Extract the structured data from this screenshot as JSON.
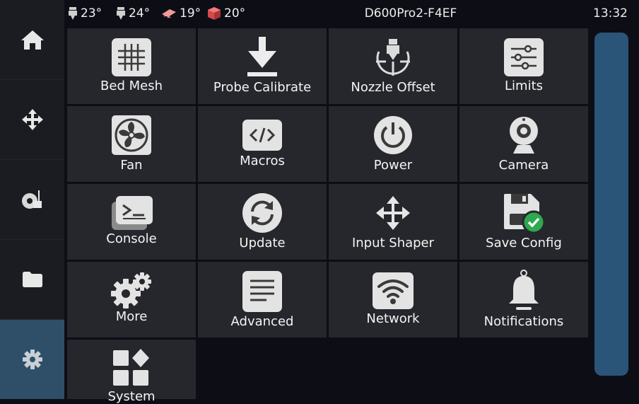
{
  "sidebar": {
    "items": [
      {
        "icon": "home-icon",
        "active": false
      },
      {
        "icon": "move-icon",
        "active": false
      },
      {
        "icon": "filament-spool-icon",
        "active": false
      },
      {
        "icon": "folder-icon",
        "active": false
      },
      {
        "icon": "gear-icon",
        "active": true
      }
    ],
    "active_color": "#2f4f69"
  },
  "status_bar": {
    "temperatures": [
      {
        "icon": "extruder-icon",
        "value": "23°"
      },
      {
        "icon": "extruder-icon",
        "value": "24°"
      },
      {
        "icon": "heated-bed-icon",
        "value": "19°"
      },
      {
        "icon": "chamber-icon",
        "value": "20°"
      }
    ],
    "printer_name": "D600Pro2-F4EF",
    "time": "13:32"
  },
  "menu": {
    "tiles": [
      {
        "label": "Bed Mesh",
        "icon": "bed-mesh-icon"
      },
      {
        "label": "Probe Calibrate",
        "icon": "probe-down-arrow-icon"
      },
      {
        "label": "Nozzle Offset",
        "icon": "nozzle-offset-icon"
      },
      {
        "label": "Limits",
        "icon": "sliders-icon"
      },
      {
        "label": "Fan",
        "icon": "fan-icon"
      },
      {
        "label": "Macros",
        "icon": "code-icon"
      },
      {
        "label": "Power",
        "icon": "power-icon"
      },
      {
        "label": "Camera",
        "icon": "webcam-icon"
      },
      {
        "label": "Console",
        "icon": "console-icon"
      },
      {
        "label": "Update",
        "icon": "refresh-icon"
      },
      {
        "label": "Input Shaper",
        "icon": "move-arrows-icon"
      },
      {
        "label": "Save Config",
        "icon": "save-check-icon"
      },
      {
        "label": "More",
        "icon": "gears-icon"
      },
      {
        "label": "Advanced",
        "icon": "document-lines-icon"
      },
      {
        "label": "Network",
        "icon": "wifi-icon"
      },
      {
        "label": "Notifications",
        "icon": "bell-icon"
      },
      {
        "label": "System",
        "icon": "system-grid-icon"
      }
    ]
  },
  "colors": {
    "background": "#0d0d16",
    "tile": "#25272c",
    "sidebar": "#1a1c21",
    "scrollbar": "#2a5478",
    "success": "#2fa84f"
  }
}
